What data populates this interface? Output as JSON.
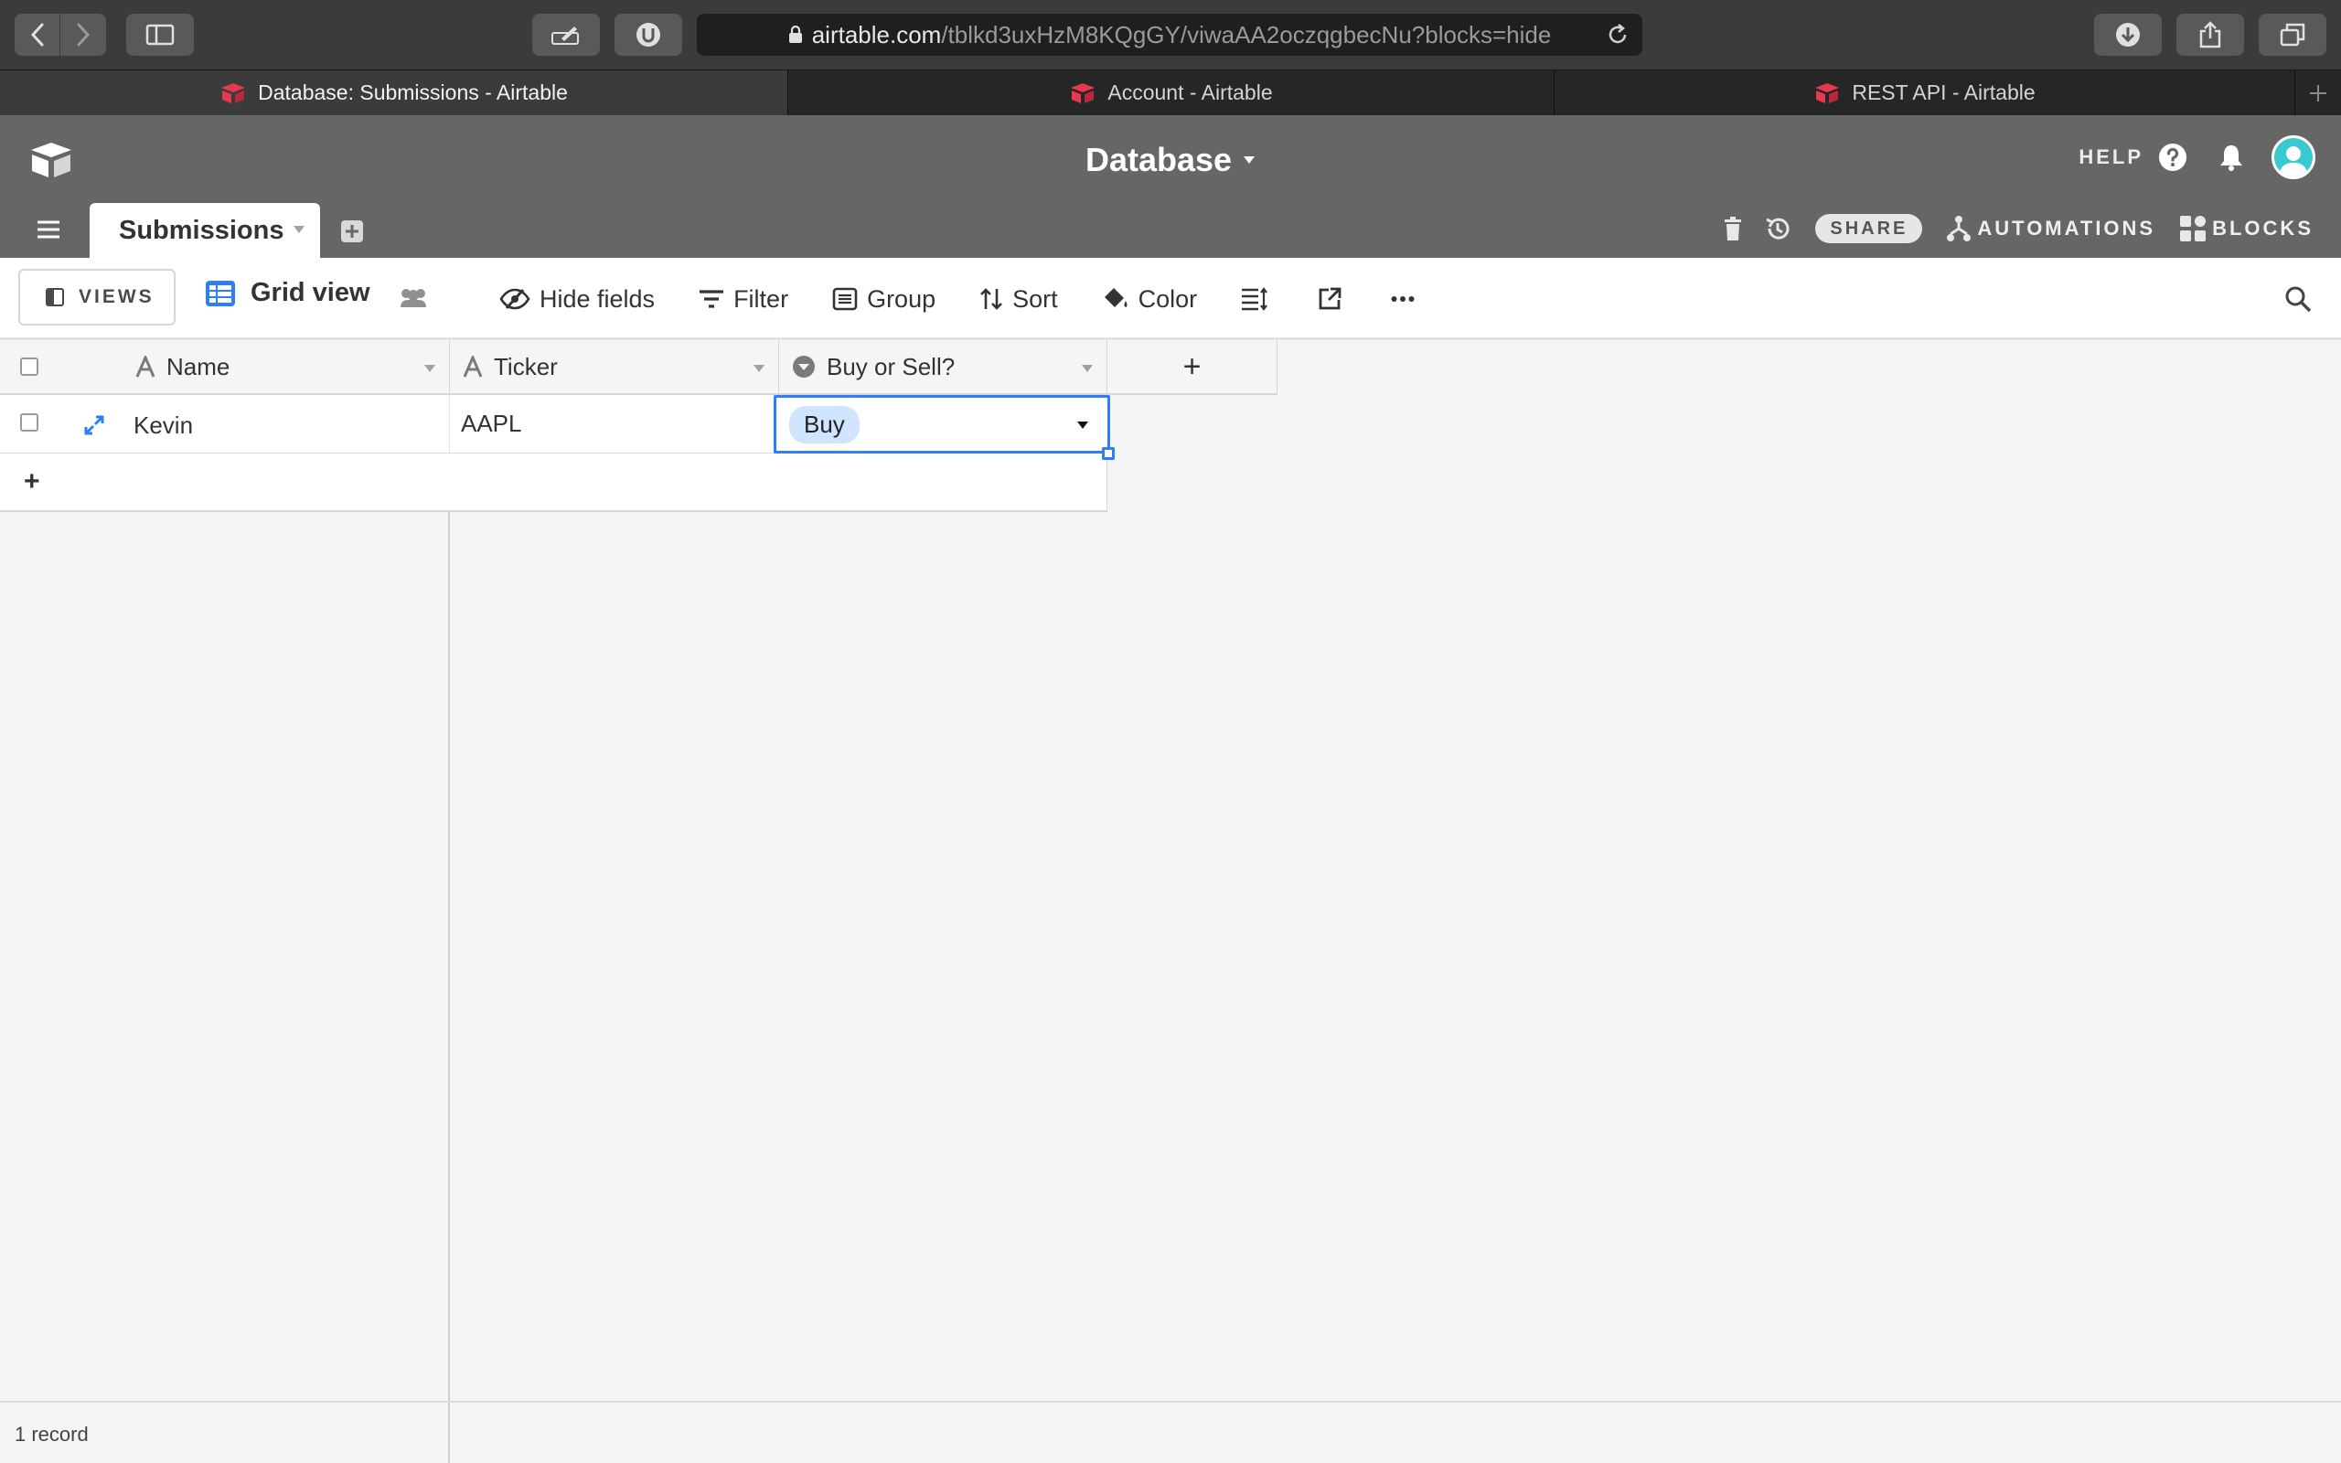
{
  "browser": {
    "url_host": "airtable.com",
    "url_path": "/tblkd3uxHzM8KQgGY/viwaAA2oczqgbecNu?blocks=hide",
    "tabs": [
      {
        "title": "Database: Submissions - Airtable",
        "active": true
      },
      {
        "title": "Account - Airtable",
        "active": false
      },
      {
        "title": "REST API - Airtable",
        "active": false
      }
    ]
  },
  "header": {
    "base_name": "Database",
    "help_label": "HELP",
    "share_label": "SHARE",
    "automations_label": "AUTOMATIONS",
    "blocks_label": "BLOCKS"
  },
  "table_tab": {
    "name": "Submissions"
  },
  "view_bar": {
    "views_label": "VIEWS",
    "view_name": "Grid view",
    "hide_fields": "Hide fields",
    "filter": "Filter",
    "group": "Group",
    "sort": "Sort",
    "color": "Color"
  },
  "grid": {
    "columns": [
      {
        "name": "Name",
        "type": "text-icon"
      },
      {
        "name": "Ticker",
        "type": "text-icon"
      },
      {
        "name": "Buy or Sell?",
        "type": "single-select-icon"
      }
    ],
    "rows": [
      {
        "name": "Kevin",
        "ticker": "AAPL",
        "buy_or_sell": "Buy"
      }
    ],
    "add_column_symbol": "+",
    "add_row_symbol": "+"
  },
  "footer": {
    "record_count": "1 record"
  },
  "colors": {
    "header_bg": "#666666",
    "selection_blue": "#2d7ff9",
    "pill_blue": "#d0e3ff",
    "avatar_teal": "#39c9d1",
    "favicon_red": "#e8384f"
  }
}
